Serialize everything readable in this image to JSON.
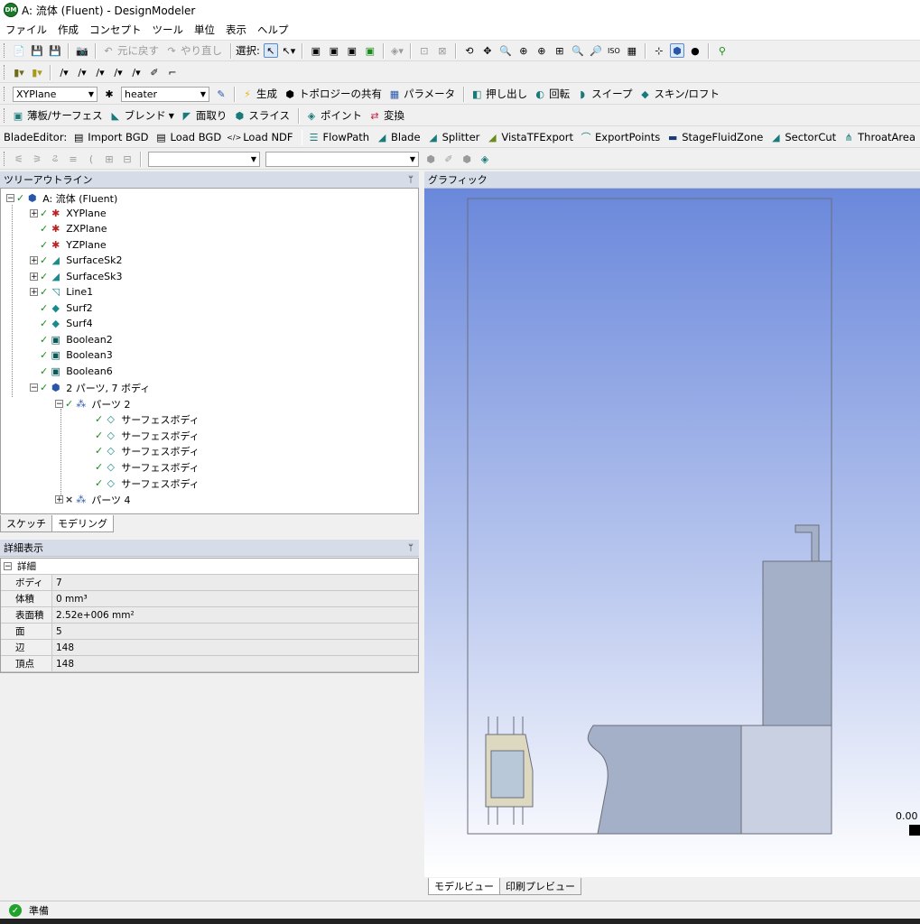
{
  "window": {
    "icon_text": "DM",
    "title": "A: 流体 (Fluent) - DesignModeler"
  },
  "menu": [
    "ファイル",
    "作成",
    "コンセプト",
    "ツール",
    "単位",
    "表示",
    "ヘルプ"
  ],
  "toolbar1": {
    "undo": "元に戻す",
    "redo": "やり直し",
    "select_label": "選択:"
  },
  "toolbar3": {
    "plane": "XYPlane",
    "sketch": "heater",
    "generate": "生成",
    "share_topology": "トポロジーの共有",
    "parameters": "パラメータ",
    "extrude": "押し出し",
    "revolve": "回転",
    "sweep": "スイープ",
    "skin_loft": "スキン/ロフト"
  },
  "toolbar4": {
    "thin_surface": "薄板/サーフェス",
    "blend": "ブレンド",
    "chamfer": "面取り",
    "slice": "スライス",
    "point": "ポイント",
    "transform": "変換"
  },
  "toolbar5": {
    "label": "BladeEditor:",
    "import_bgd": "Import BGD",
    "load_bgd": "Load BGD",
    "load_ndf": "Load NDF",
    "flowpath": "FlowPath",
    "blade": "Blade",
    "splitter": "Splitter",
    "vista": "VistaTFExport",
    "export_points": "ExportPoints",
    "stage_fluid": "StageFluidZone",
    "sector_cut": "SectorCut",
    "throat_area": "ThroatArea"
  },
  "tree_panel": {
    "title": "ツリーアウトライン",
    "pin": "ᛘ"
  },
  "tree": {
    "root": "A: 流体 (Fluent)",
    "items": [
      "XYPlane",
      "ZXPlane",
      "YZPlane",
      "SurfaceSk2",
      "SurfaceSk3",
      "Line1",
      "Surf2",
      "Surf4",
      "Boolean2",
      "Boolean3",
      "Boolean6"
    ],
    "parts_node": "2 パーツ, 7 ボディ",
    "part2": "パーツ 2",
    "bodies": [
      "サーフェスボディ",
      "サーフェスボディ",
      "サーフェスボディ",
      "サーフェスボディ",
      "サーフェスボディ"
    ],
    "part4": "パーツ 4"
  },
  "tree_tabs": [
    "スケッチ",
    "モデリング"
  ],
  "details_panel": {
    "title": "詳細表示",
    "pin": "ᛘ",
    "section": "詳細",
    "rows": [
      {
        "key": "ボディ",
        "value": "7"
      },
      {
        "key": "体積",
        "value": "0 mm³"
      },
      {
        "key": "表面積",
        "value": "2.52e+006 mm²"
      },
      {
        "key": "面",
        "value": "5"
      },
      {
        "key": "辺",
        "value": "148"
      },
      {
        "key": "頂点",
        "value": "148"
      }
    ]
  },
  "graphics": {
    "title": "グラフィック",
    "scale_label": "0.00"
  },
  "graphics_tabs": [
    "モデルビュー",
    "印刷プレビュー"
  ],
  "status": {
    "text": "準備"
  },
  "colors": {
    "panel_header": "#d7dde8",
    "viewport_top": "#6a88db",
    "geometry_fill": "#a4b0c8",
    "heater_fill": "#ddd8c0"
  }
}
